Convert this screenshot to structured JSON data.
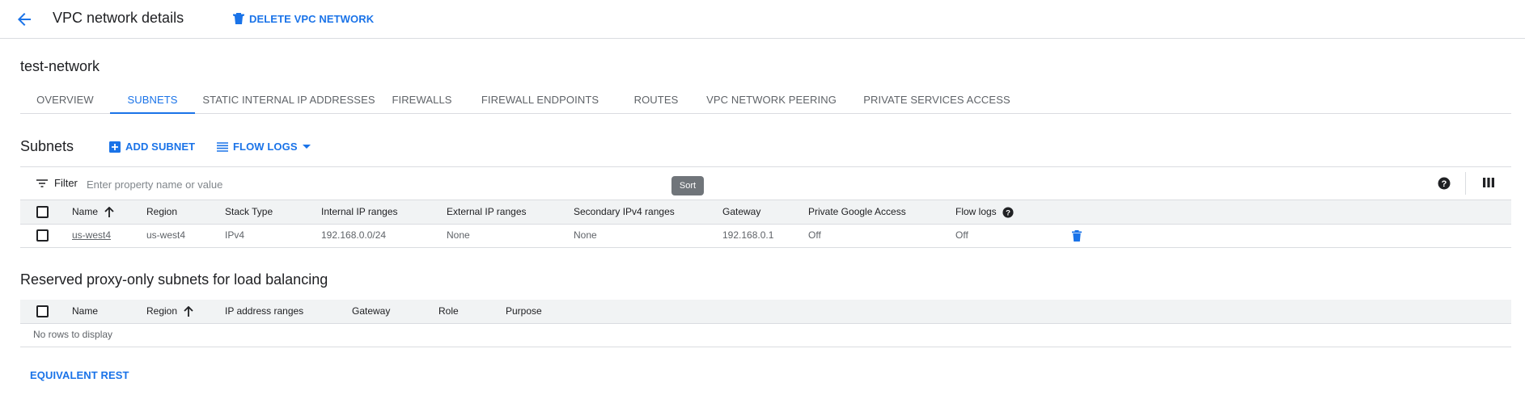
{
  "header": {
    "title": "VPC network details",
    "delete_label": "DELETE VPC NETWORK"
  },
  "network": {
    "name": "test-network"
  },
  "tabs": [
    {
      "label": "OVERVIEW"
    },
    {
      "label": "SUBNETS"
    },
    {
      "label": "STATIC INTERNAL IP ADDRESSES"
    },
    {
      "label": "FIREWALLS"
    },
    {
      "label": "FIREWALL ENDPOINTS"
    },
    {
      "label": "ROUTES"
    },
    {
      "label": "VPC NETWORK PEERING"
    },
    {
      "label": "PRIVATE SERVICES ACCESS"
    }
  ],
  "active_tab": "SUBNETS",
  "subnets": {
    "title": "Subnets",
    "add_label": "ADD SUBNET",
    "flow_logs_label": "FLOW LOGS",
    "filter_label": "Filter",
    "filter_placeholder": "Enter property name or value",
    "sort_tooltip": "Sort",
    "columns": [
      "Name",
      "Region",
      "Stack Type",
      "Internal IP ranges",
      "External IP ranges",
      "Secondary IPv4 ranges",
      "Gateway",
      "Private Google Access",
      "Flow logs"
    ],
    "rows": [
      {
        "name": "us-west4",
        "region": "us-west4",
        "stack_type": "IPv4",
        "internal_ip": "192.168.0.0/24",
        "external_ip": "None",
        "secondary": "None",
        "gateway": "192.168.0.1",
        "pga": "Off",
        "flow_logs": "Off"
      }
    ]
  },
  "proxy_subnets": {
    "title": "Reserved proxy-only subnets for load balancing",
    "columns": [
      "Name",
      "Region",
      "IP address ranges",
      "Gateway",
      "Role",
      "Purpose"
    ],
    "empty_text": "No rows to display"
  },
  "footer": {
    "equivalent_rest_label": "EQUIVALENT REST"
  },
  "icons": {
    "back": "arrow-left",
    "delete": "trash",
    "add": "plus-box",
    "flow_logs": "list-lines",
    "dropdown": "caret-down",
    "filter": "filter-lines",
    "help": "question-circle",
    "columns": "column-display",
    "sort": "arrow-up"
  },
  "colors": {
    "accent": "#1a73e8",
    "text": "#202124",
    "muted": "#5f6368",
    "border": "#dadce0",
    "header_bg": "#f1f3f4"
  }
}
